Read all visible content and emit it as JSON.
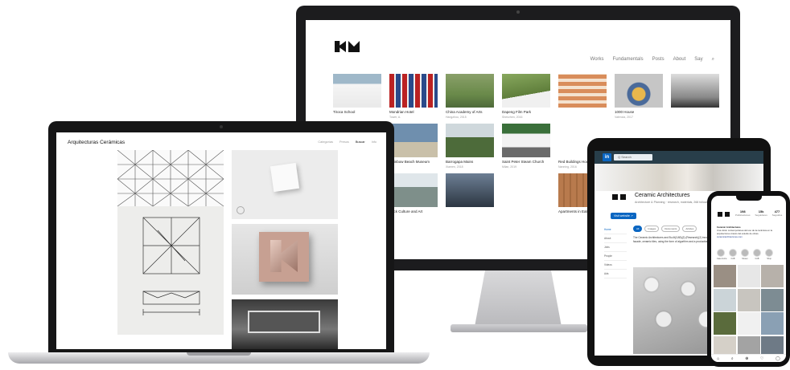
{
  "monitor": {
    "nav": [
      "Works",
      "Fundamentals",
      "Posts",
      "About",
      "Say",
      "⌕"
    ],
    "tiles": [
      {
        "title": "Tiroca School",
        "sub": "",
        "img": "linear-gradient(180deg,#9fb8c9 0 30%,#f5f5f5 30%,#e9e9e9)"
      },
      {
        "title": "Mondrian Hotel",
        "sub": "Tower, A.",
        "img": "repeating-linear-gradient(90deg,#b22 0 6px,#eee 6px 8px,#2a4a8a 8px 14px,#eee 14px 16px)"
      },
      {
        "title": "China Academy of Arts",
        "sub": "Hangzhou, 2015",
        "img": "linear-gradient(180deg,#8aa06a 0,#6a8a4a 60%,#4e6a3a)"
      },
      {
        "title": "Dapeng Film Park",
        "sub": "Shenzhen, 2016",
        "img": "linear-gradient(170deg,#88a85e 0,#5f7e3b 60%,#f0f0f0 60%)"
      },
      {
        "title": "",
        "sub": "",
        "img": "repeating-linear-gradient(0deg,#d98d5b 0 5px,#f4e2cf 5px 9px)"
      },
      {
        "title": "1000 House",
        "sub": "Valencia, 2017",
        "img": "radial-gradient(circle at 50% 60%,#e8b74c 0 8px,#4a6a9a 9px 14px,#c6c6c6 15px)"
      },
      {
        "title": "",
        "sub": "",
        "img": "linear-gradient(180deg,#ddd 0,#888 70%,#333)"
      },
      {
        "title": "",
        "sub": "",
        "img": "#ffffff"
      },
      {
        "title": "Rainbow Beach Museum",
        "sub": "",
        "img": "linear-gradient(180deg,#6f8fae 0 55%,#c9c0a9 55%)"
      },
      {
        "title": "Barrogapa Mains",
        "sub": "Xiamen, 2018",
        "img": "linear-gradient(180deg,#cfd8dc 0 40%,#4d6b3a 40%)"
      },
      {
        "title": "Saint Peter Steam Church",
        "sub": "Milan, 2019",
        "img": "linear-gradient(180deg,#3a6f3a 0 30%,#f2f2f2 30% 70%,#6a6a6a 70%)"
      },
      {
        "title": "Red Buildings House",
        "sub": "Nanning, 2016",
        "img": "#ffffff"
      },
      {
        "title": "",
        "sub": "",
        "img": "#ffffff"
      },
      {
        "title": "",
        "sub": "",
        "img": "#ffffff"
      },
      {
        "title": "",
        "sub": "",
        "img": "#ffffff"
      },
      {
        "title": "Brick Culture and Art",
        "sub": "",
        "img": "linear-gradient(180deg,#dfe6ea 0 40%,#7e8f8a 40%)"
      },
      {
        "title": "",
        "sub": "",
        "img": "linear-gradient(180deg,#6d7f94 0,#2c3642)"
      },
      {
        "title": "",
        "sub": "",
        "img": "#ffffff"
      },
      {
        "title": "Apartments in Ealm Ha...",
        "sub": "",
        "img": "repeating-linear-gradient(90deg,#b87a4d 0 6px,#a46a3f 6px 8px)"
      },
      {
        "title": "",
        "sub": "",
        "img": "#ffffff"
      },
      {
        "title": "",
        "sub": "",
        "img": "#ffffff"
      }
    ]
  },
  "laptop": {
    "title": "Arquitecturas Cerámicas",
    "nav": [
      "Categorías",
      "Presos",
      "Buscar",
      "Info"
    ],
    "active_nav": "Buscar"
  },
  "tablet": {
    "app_letter": "in",
    "search": "Q Search",
    "company": "Ceramic Architectures",
    "company_sub": "Architecture & Planning · research, materials, 268 followers",
    "button": "Visit website ↗",
    "side": [
      "Home",
      "About",
      "Jobs",
      "People",
      "Videos",
      "Ads"
    ],
    "tabs": [
      "All",
      "Images",
      "Documents",
      "Articles"
    ],
    "post": "The Ceramic Architectures and Bu-ilt(CAB)(2) (Research)(2) innovating and fabricated a new way of facade, ceramic tiles, using the form of algorithm and a production process..."
  },
  "phone": {
    "stats": [
      {
        "value": "198",
        "label": "Publicaciones"
      },
      {
        "value": "15k",
        "label": "Seguidores"
      },
      {
        "value": "477",
        "label": "Seguidos"
      }
    ],
    "name": "Ceramic Architectures",
    "bio": "Una visión contemporánea del uso de la cerámica en la arquitectura a través del estudio de obras.",
    "link": "ceramicarchitectures.com",
    "highlights": [
      "Casa Gorra",
      "CAB",
      "Museo",
      "CAB",
      "Shop"
    ],
    "grid_colors": [
      "#9a8f84",
      "#e7e7e7",
      "#b7b1aa",
      "#cbd4d8",
      "#c8c5bf",
      "#7d8c93",
      "#5a6b3c",
      "#f0f0f0",
      "#8aa0b4",
      "#d5d0c8",
      "#a3a3a3",
      "#6e7a86"
    ],
    "nav_icons": [
      "⌂",
      "⌕",
      "⊕",
      "♡",
      "◯"
    ]
  }
}
